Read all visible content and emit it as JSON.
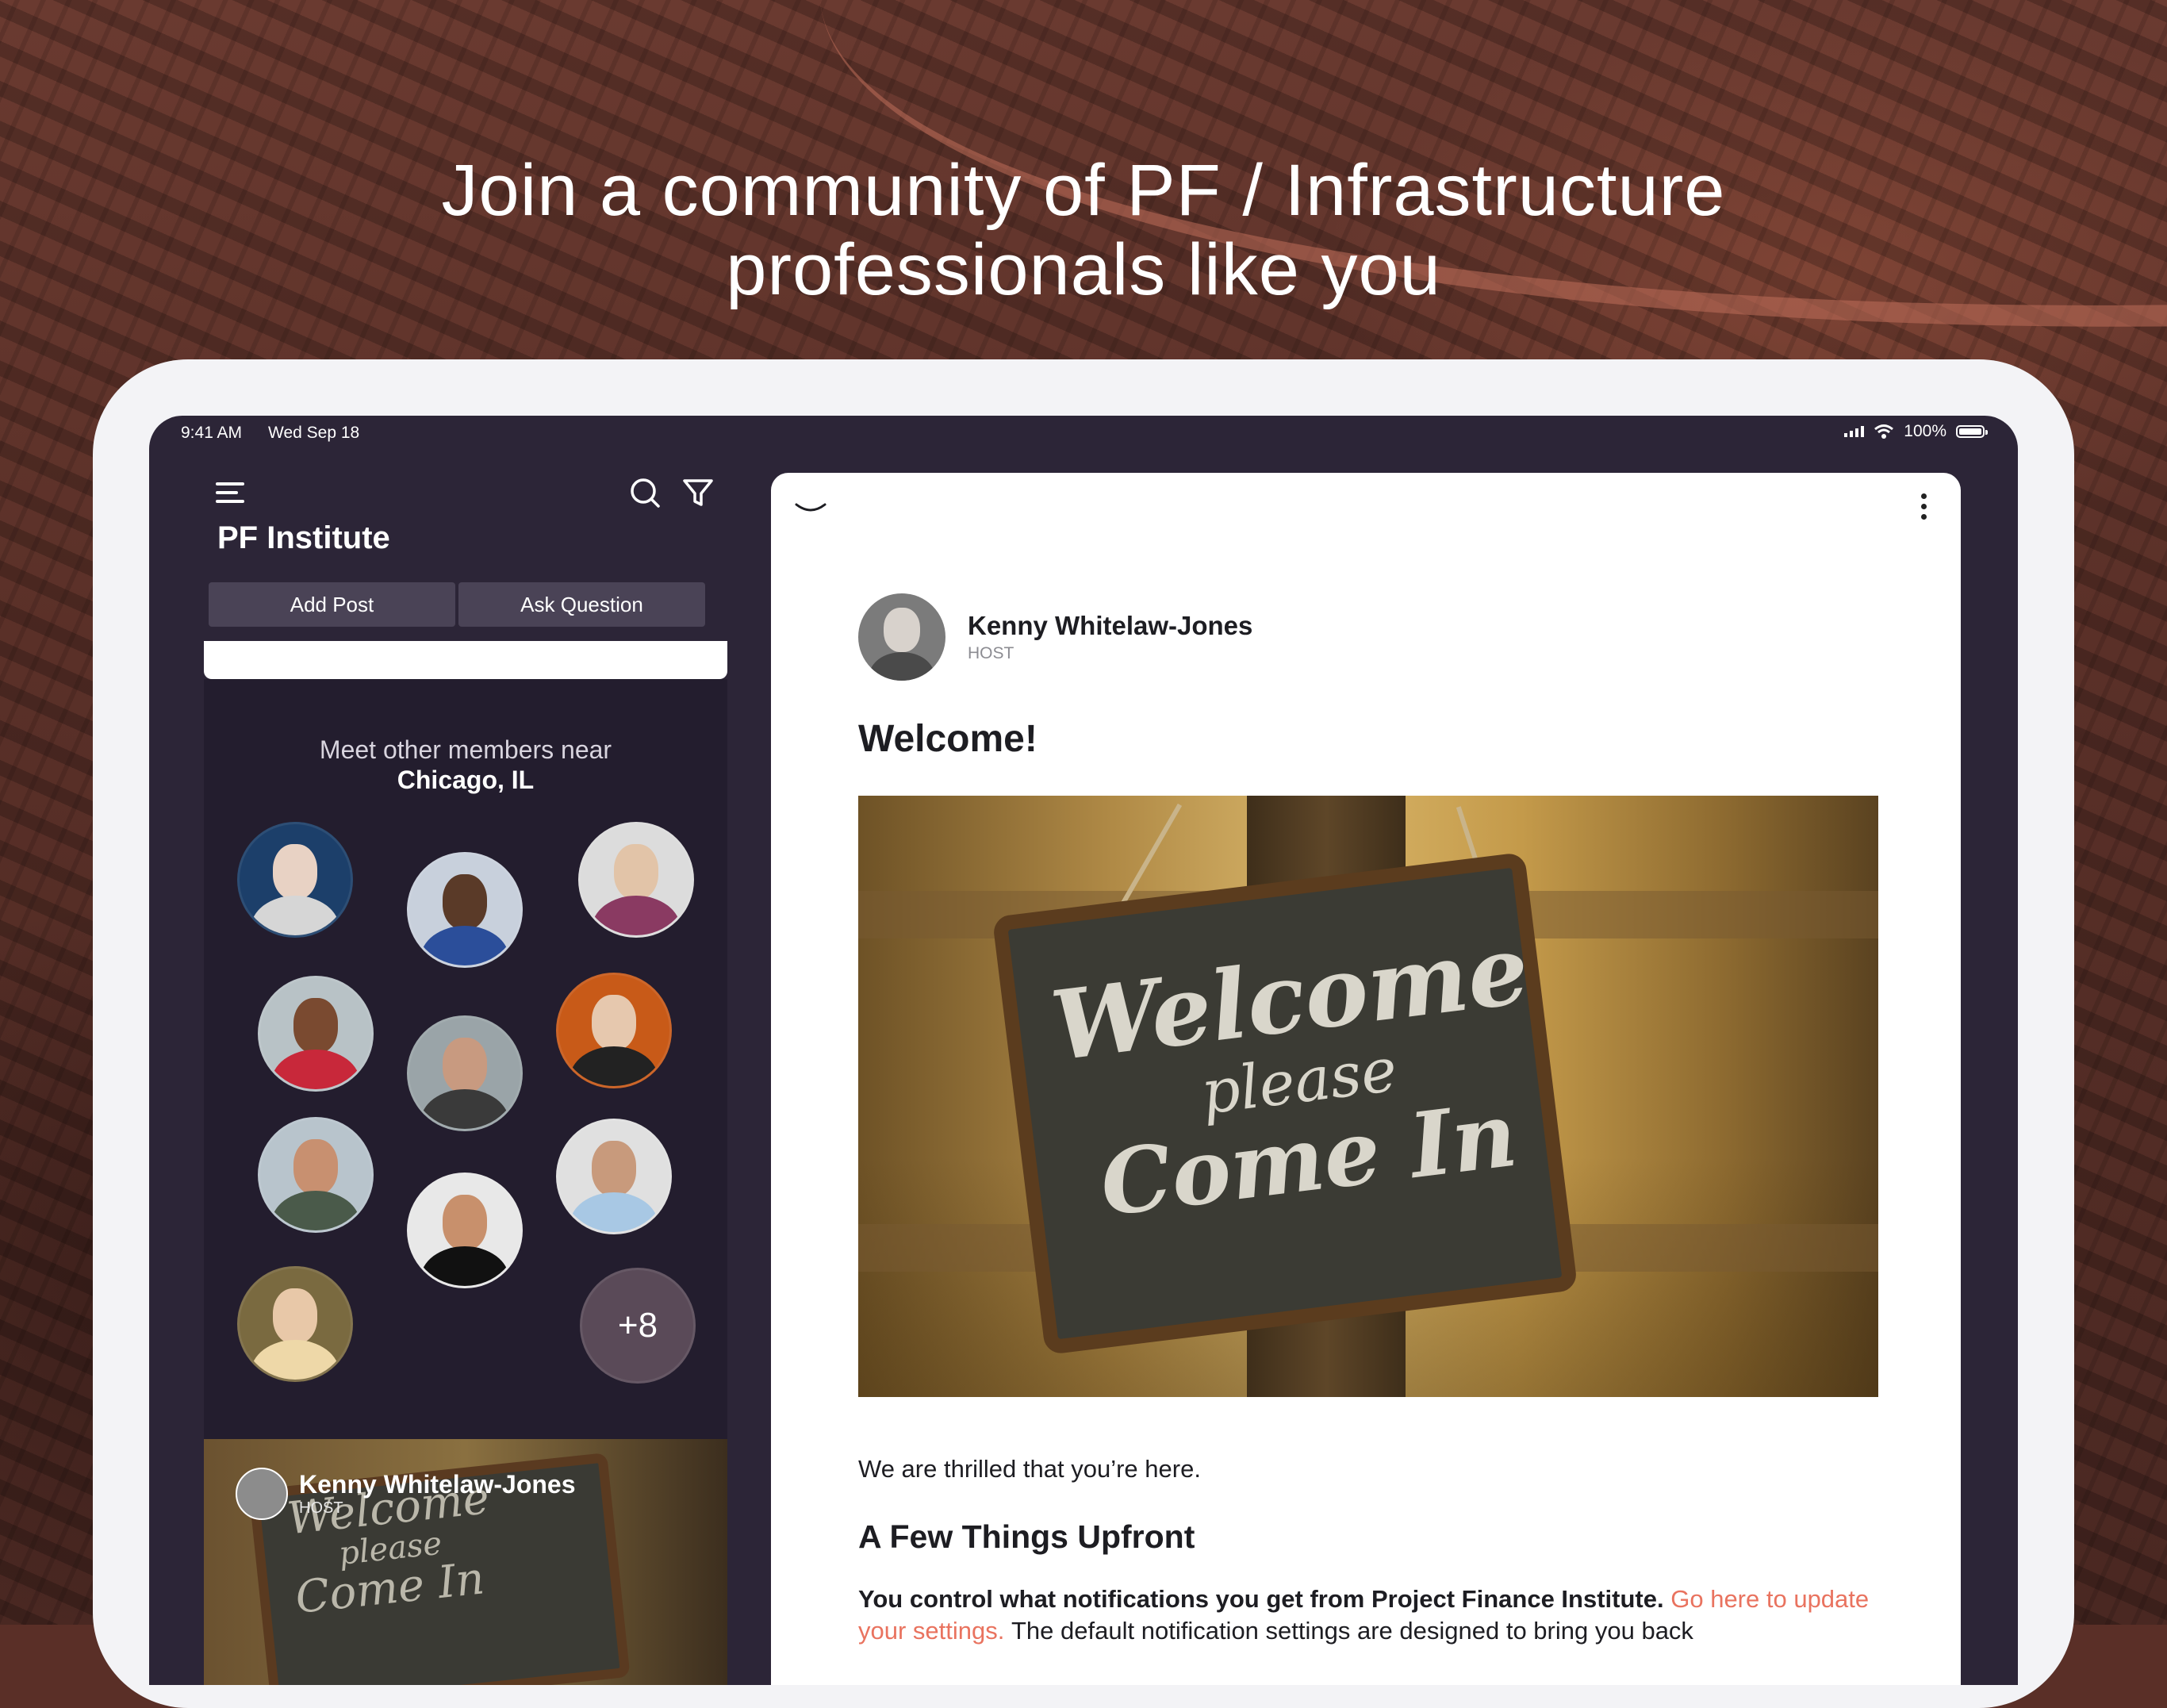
{
  "headline": {
    "line1": "Join a community of PF / Infrastructure",
    "line2": "professionals like you"
  },
  "status_bar": {
    "time": "9:41 AM",
    "date": "Wed Sep 18",
    "battery": "100%"
  },
  "sidebar": {
    "title": "PF Institute",
    "tabs": [
      "Add Post",
      "Ask Question"
    ],
    "members_heading": "Meet other members near",
    "members_location": "Chicago, IL",
    "more_count": "+8",
    "preview_author": "Kenny Whitelaw-Jones",
    "preview_role": "HOST",
    "preview_chalk": [
      "Welcome",
      "please",
      "Come In"
    ]
  },
  "post": {
    "author": "Kenny Whitelaw-Jones",
    "role": "HOST",
    "title": "Welcome!",
    "image_chalk": [
      "Welcome",
      "please",
      "Come In"
    ],
    "intro": "We are thrilled that you’re here.",
    "section_heading": "A Few Things Upfront",
    "notif_bold": "You control what notifications you get from Project Finance Institute.",
    "notif_link": "Go here to update your settings.",
    "notif_rest": "The default notification settings are designed to bring you back"
  },
  "colors": {
    "accent_link": "#e9735f",
    "sidebar_bg": "#2c2537",
    "members_bg": "#231d2e",
    "tab_bg": "#4a4356"
  },
  "icons": {
    "menu": "menu-icon",
    "search": "search-icon",
    "filter": "filter-icon",
    "collapse": "chevron-down-icon",
    "more": "more-vertical-icon"
  }
}
